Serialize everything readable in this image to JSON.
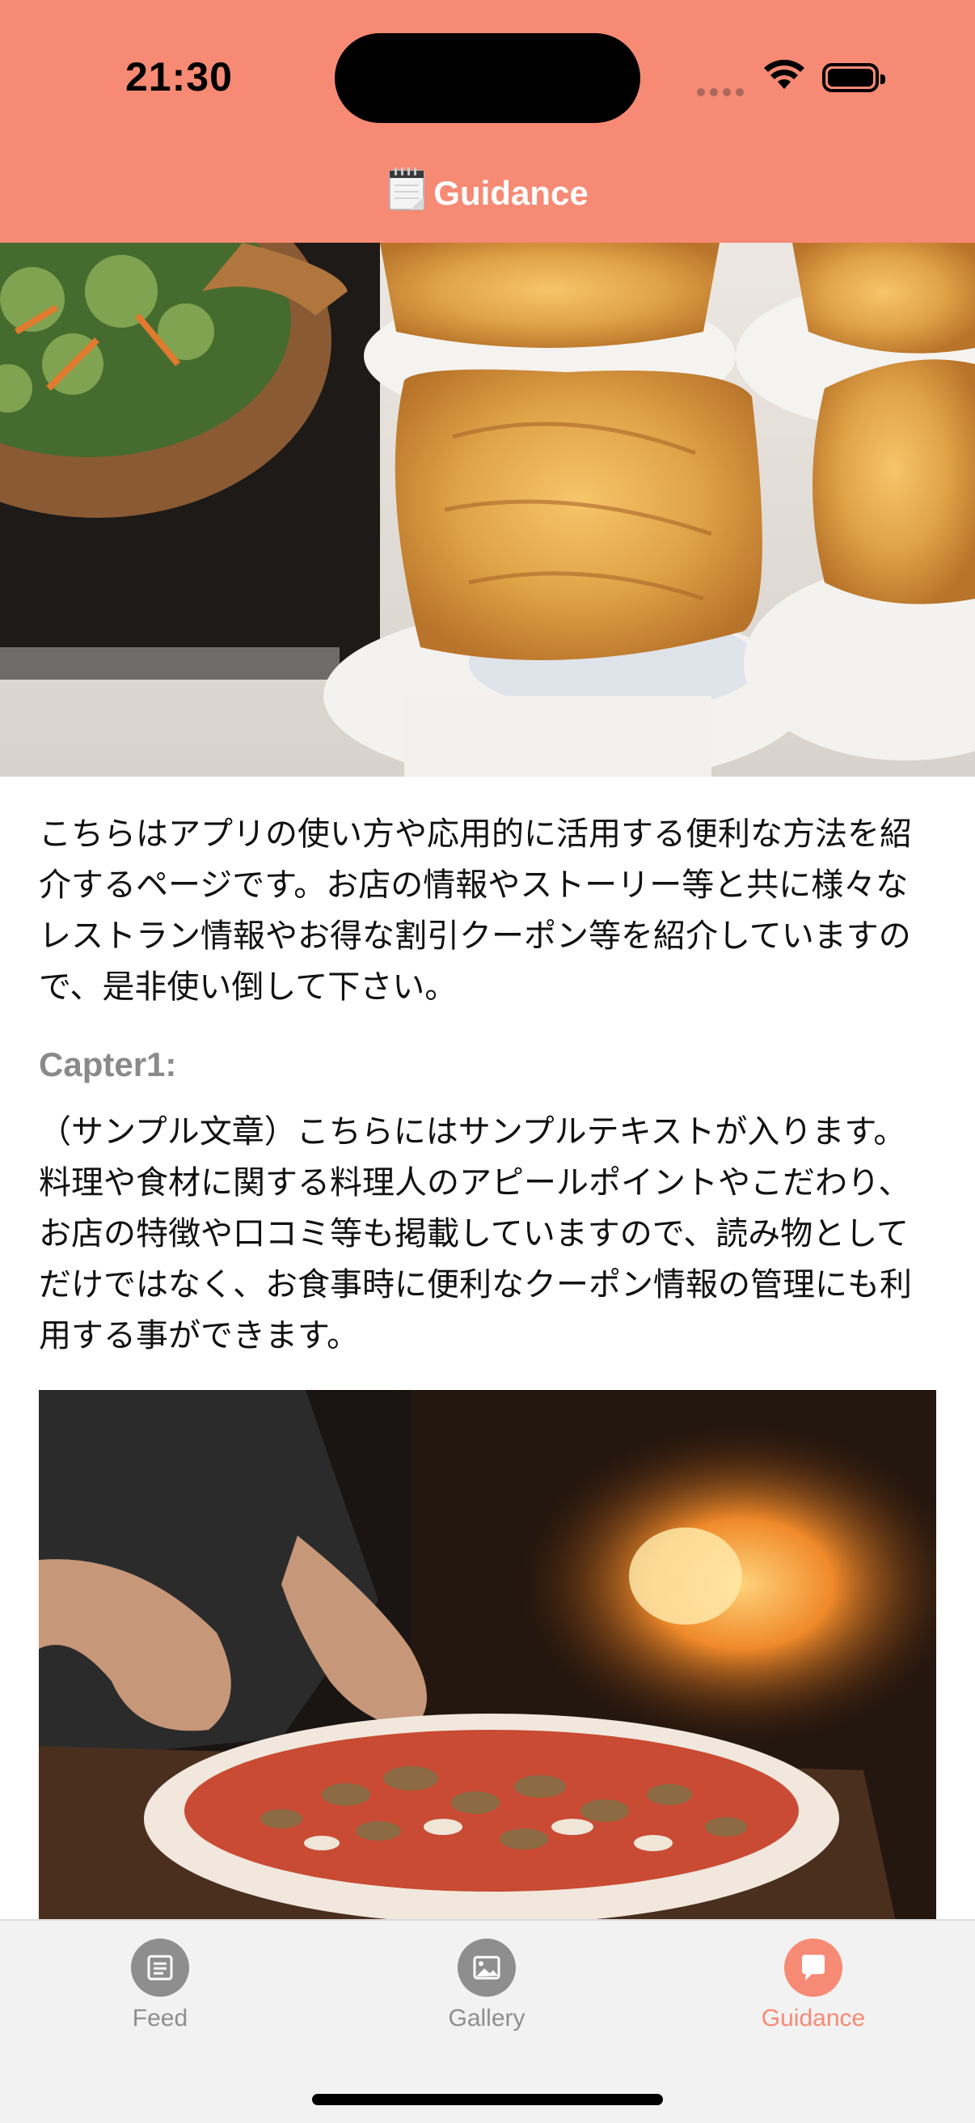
{
  "status_bar": {
    "time": "21:30"
  },
  "nav": {
    "title": "Guidance",
    "title_icon": "notepad-icon"
  },
  "intro_text": "こちらはアプリの使い方や応用的に活用する便利な方法を紹介するページです。お店の情報やストーリー等と共に様々なレストラン情報やお得な割引クーポン等を紹介していますので、是非使い倒して下さい。",
  "chapter": {
    "heading": "Capter1:",
    "body": "（サンプル文章）こちらにはサンプルテキストが入ります。料理や食材に関する料理人のアピールポイントやこだわり、お店の特徴や口コミ等も掲載していますので、読み物としてだけではなく、お食事時に便利なクーポン情報の管理にも利用する事ができます。"
  },
  "tabs": [
    {
      "label": "Feed",
      "icon": "feed-icon",
      "active": false
    },
    {
      "label": "Gallery",
      "icon": "gallery-icon",
      "active": false
    },
    {
      "label": "Guidance",
      "icon": "chat-bubble-icon",
      "active": true
    }
  ],
  "colors": {
    "accent": "#f78a74",
    "inactive": "#8e8e8e"
  }
}
